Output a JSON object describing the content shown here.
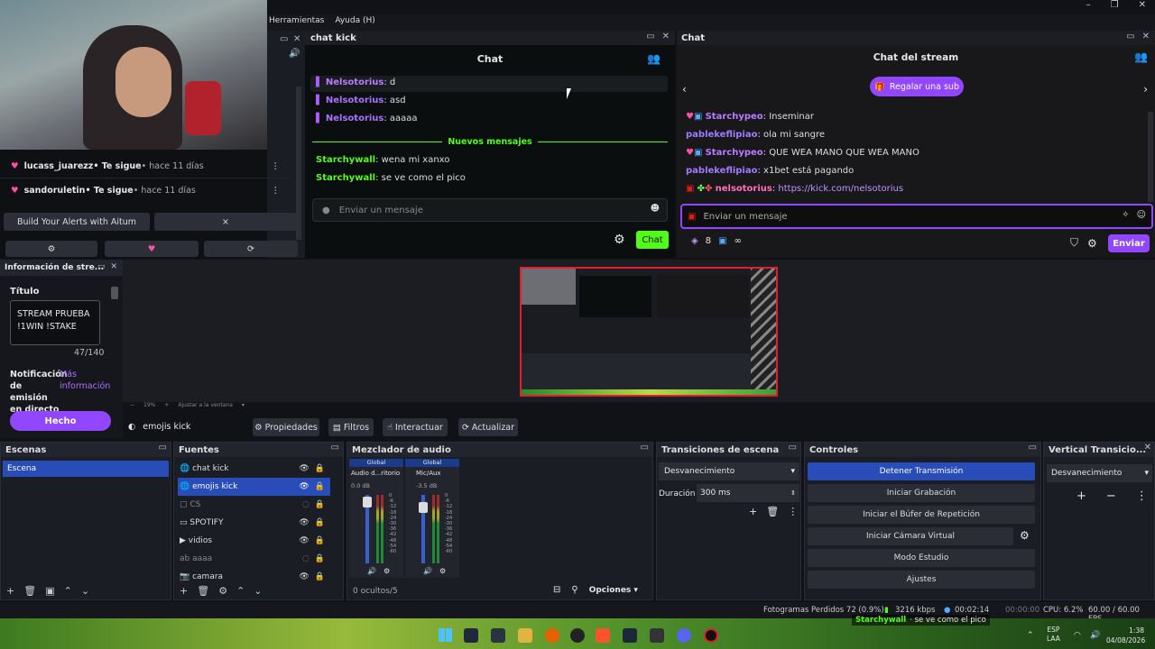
{
  "menubar": {
    "tools": "Herramientas",
    "help": "Ayuda (H)"
  },
  "kick_dock": {
    "dock_title": "chat kick",
    "chat_header": "Chat",
    "messages": [
      {
        "user": "Nelsotorius",
        "text": ": d"
      },
      {
        "user": "Nelsotorius",
        "text": ": asd"
      },
      {
        "user": "Nelsotorius",
        "text": ": aaaaa"
      }
    ],
    "new_messages": "Nuevos mensajes",
    "new": [
      {
        "user": "Starchywall",
        "text": ": wena mi xanxo"
      },
      {
        "user": "Starchywall",
        "text": ": se ve como el pico"
      }
    ],
    "input_placeholder": "Enviar un mensaje",
    "send_label": "Chat"
  },
  "twitch_dock": {
    "dock_title": "Chat",
    "chat_header": "Chat del stream",
    "gift_sub": "Regalar una sub",
    "messages": [
      {
        "user": "Starchypeo",
        "text": ": Inseminar",
        "color": "#b77cff"
      },
      {
        "user": "pablekeflipiao",
        "text": ": ola mi sangre",
        "color": "#9f7bff"
      },
      {
        "user": "Starchypeo",
        "text": ": QUE WEA MANO QUE WEA MANO",
        "color": "#b77cff"
      },
      {
        "user": "pablekeflipiao",
        "text": ": x1bet está pagando",
        "color": "#9f7bff"
      },
      {
        "user": "nelsotorius",
        "text": ": ",
        "link": "https://kick.com/nelsotorius",
        "color": "#ff6eb4"
      }
    ],
    "input_placeholder": "Enviar un mensaje",
    "points": "8",
    "infinity": "∞",
    "send_label": "Enviar"
  },
  "alerts_dock": {
    "followers": [
      {
        "name": "lucass_juarezz",
        "action": " • Te sigue",
        "time": " • hace 11 días"
      },
      {
        "name": "sandoruletin",
        "action": " • Te sigue",
        "time": " • hace 11 días"
      }
    ],
    "alitum_label": "Build Your Alerts with Aitum",
    "close_x": "×"
  },
  "stream_info": {
    "dock_title": "Información de stre...",
    "title_label": "Título",
    "title_value": "STREAM PRUEBA !1WIN !STAKE",
    "char_count": "47/140",
    "notif_label": "Notificación de emisión en directo",
    "more_info": "Más información",
    "done": "Hecho"
  },
  "preview": {
    "zoom": "19%",
    "fit": "Ajustar a la ventana"
  },
  "source_toolbar": {
    "source": "emojis kick",
    "props": "Propiedades",
    "filters": "Filtros",
    "interact": "Interactuar",
    "refresh": "Actualizar"
  },
  "scenes": {
    "title": "Escenas",
    "items": [
      "Escena"
    ]
  },
  "sources": {
    "title": "Fuentes",
    "items": [
      "chat kick",
      "emojis kick",
      "CS",
      "SPOTIFY",
      "vidios",
      "aaaa",
      "camara"
    ]
  },
  "mixer": {
    "title": "Mezclador de audio",
    "channels": [
      {
        "tag": "Global",
        "name": "Audio d...ritorio",
        "db": "0.0 dB"
      },
      {
        "tag": "Global",
        "name": "Mic/Aux",
        "db": "-3.5 dB"
      }
    ],
    "scale": [
      "0",
      "-6",
      "-12",
      "-18",
      "-24",
      "-30",
      "-36",
      "-42",
      "-48",
      "-54",
      "-60"
    ],
    "hidden": "0 ocultos/5",
    "options": "Opciones"
  },
  "transitions": {
    "title": "Transiciones de escena",
    "type": "Desvanecimiento",
    "duration_label": "Duración",
    "duration": "300 ms"
  },
  "controls": {
    "title": "Controles",
    "buttons": [
      "Detener Transmisión",
      "Iniciar Grabación",
      "Iniciar el Búfer de Repetición",
      "Iniciar Cámara Virtual",
      "Modo Estudio",
      "Ajustes"
    ]
  },
  "vertical": {
    "title": "Vertical Transicio...",
    "type": "Desvanecimiento"
  },
  "statusbar": {
    "dropped": "Fotogramas Perdidos 72 (0.9%)",
    "kbps": "3216 kbps",
    "time1": "00:02:14",
    "time2": "00:00:00",
    "cpu": "CPU: 6.2%",
    "fps": "60.00 / 60.00 FPS"
  },
  "taskbar": {
    "notif_user": "Starchywall",
    "notif_text": "· se ve como el pico",
    "lang1": "ESP",
    "lang2": "LAA",
    "clock": "1:38",
    "date": "04/08/2026"
  },
  "colors": {
    "kick": "#53fc18",
    "twitch": "#9147ff",
    "obs_accent": "#284cb8"
  }
}
